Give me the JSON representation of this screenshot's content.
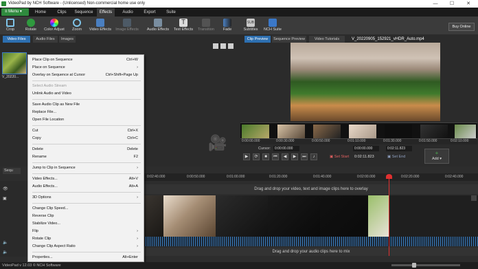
{
  "window": {
    "title": "VideoPad by NCH Software - (Unlicensed) Non-commercial home use only",
    "controls": [
      "—",
      "☐",
      "✕"
    ]
  },
  "menubar": {
    "menu_button": "Menu",
    "tabs": [
      "Home",
      "Clips",
      "Sequence",
      "Effects",
      "Audio",
      "Export",
      "Suite"
    ],
    "active_tab": "Effects"
  },
  "toolbar": {
    "tools": [
      "Crop",
      "Rotate",
      "Color Adjust",
      "Zoom",
      "Video Effects",
      "Image Effects",
      "Audio Effects",
      "Text Effects",
      "Transition",
      "Fade",
      "Subtitles",
      "NCH Suite"
    ],
    "buy_online": "Buy Online"
  },
  "bin": {
    "tabs": [
      "Video Files",
      "Audio Files",
      "Images"
    ],
    "active_tab": "Video Files",
    "file_name": "V_20220..."
  },
  "preview": {
    "tabs": [
      "Clip Preview",
      "Sequence Preview",
      "Video Tutorials"
    ],
    "active_tab": "Clip Preview",
    "clip_name": "V_20220905_152921_vHDR_Auto.mp4",
    "ruler_ticks": [
      "0:00:00.000",
      "0:00:30.000",
      "0:00:50.000",
      "0:01:10.000",
      "0:01:30.000",
      "0:01:50.000",
      "0:02:10.000"
    ],
    "cursor_label": "Cursor:",
    "cursor_time": "0:00:00.000",
    "start_time": "0:00:00.000",
    "end_time": "0:02:11.823",
    "duration": "0:02:11.823",
    "set_start": "Set Start",
    "set_end": "Set End",
    "add_button": "Add"
  },
  "context_menu": {
    "items": [
      {
        "label": "Place Clip on Sequence",
        "shortcut": "Ctrl+W",
        "submenu": false,
        "disabled": false
      },
      {
        "label": "Place on Sequence",
        "shortcut": "",
        "submenu": true,
        "disabled": false
      },
      {
        "label": "Overlay on Sequence at Cursor",
        "shortcut": "Ctrl+Shift+Page Up",
        "submenu": false,
        "disabled": false
      },
      {
        "label": "Select Audio Stream",
        "shortcut": "",
        "submenu": false,
        "disabled": true
      },
      {
        "label": "Unlink Audio and Video",
        "shortcut": "",
        "submenu": false,
        "disabled": false
      },
      {
        "label": "Save Audio Clip as New File",
        "shortcut": "",
        "submenu": false,
        "disabled": false
      },
      {
        "label": "Replace File...",
        "shortcut": "",
        "submenu": false,
        "disabled": false
      },
      {
        "label": "Open File Location",
        "shortcut": "",
        "submenu": false,
        "disabled": false
      },
      {
        "label": "Cut",
        "shortcut": "Ctrl+X",
        "submenu": false,
        "disabled": false
      },
      {
        "label": "Copy",
        "shortcut": "Ctrl+C",
        "submenu": false,
        "disabled": false
      },
      {
        "label": "Delete",
        "shortcut": "Delete",
        "submenu": false,
        "disabled": false
      },
      {
        "label": "Rename",
        "shortcut": "F2",
        "submenu": false,
        "disabled": false
      },
      {
        "label": "Jump to Clip in Sequence",
        "shortcut": "",
        "submenu": true,
        "disabled": false
      },
      {
        "label": "Video Effects...",
        "shortcut": "Alt+V",
        "submenu": false,
        "disabled": false
      },
      {
        "label": "Audio Effects...",
        "shortcut": "Alt+A",
        "submenu": false,
        "disabled": false
      },
      {
        "label": "3D Options",
        "shortcut": "",
        "submenu": true,
        "disabled": false
      },
      {
        "label": "Change Clip Speed...",
        "shortcut": "",
        "submenu": false,
        "disabled": false
      },
      {
        "label": "Reverse Clip",
        "shortcut": "",
        "submenu": false,
        "disabled": false
      },
      {
        "label": "Stabilize Video...",
        "shortcut": "",
        "submenu": false,
        "disabled": false
      },
      {
        "label": "Flip",
        "shortcut": "",
        "submenu": true,
        "disabled": false
      },
      {
        "label": "Rotate Clip",
        "shortcut": "",
        "submenu": true,
        "disabled": false
      },
      {
        "label": "Change Clip Aspect Ratio",
        "shortcut": "",
        "submenu": true,
        "disabled": false
      },
      {
        "label": "Properties...",
        "shortcut": "Alt+Enter",
        "submenu": false,
        "disabled": false
      }
    ]
  },
  "timeline": {
    "sequence_tab": "Sequ",
    "ruler_ticks": [
      "0:02:40.000",
      "0:00:50.000",
      "0:01:00.000",
      "0:01:20.000",
      "0:01:40.000",
      "0:02:00.000",
      "0:02:20.000",
      "0:02:40.000"
    ],
    "video_drop_hint": "Drag and drop your video, text and image clips here to overlay",
    "audio_drop_hint": "Drag and drop your audio clips here to mix"
  },
  "status": {
    "text": "VideoPad v 12.03 © NCH Software"
  },
  "colors": {
    "accent_green": "#2f8a3e",
    "tab_blue": "#2d6fb0",
    "playhead_red": "#e03030"
  }
}
